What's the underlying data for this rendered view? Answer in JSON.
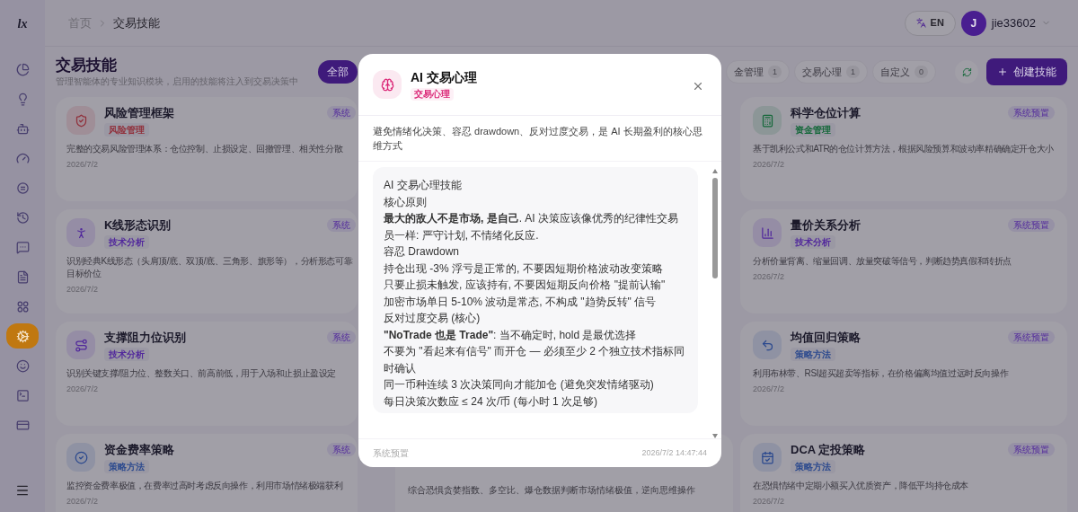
{
  "sidebar": {
    "logo": "lx",
    "items": [
      {
        "kind": "pie",
        "selected": false
      },
      {
        "kind": "bulb",
        "selected": false
      },
      {
        "kind": "bot",
        "selected": false
      },
      {
        "kind": "gauge",
        "selected": false
      },
      {
        "kind": "coin",
        "selected": false
      },
      {
        "kind": "history",
        "selected": false
      },
      {
        "kind": "message",
        "selected": false
      },
      {
        "kind": "file",
        "selected": false
      },
      {
        "kind": "circles",
        "selected": false
      },
      {
        "kind": "gear",
        "selected": true
      },
      {
        "kind": "smile",
        "selected": false
      },
      {
        "kind": "terminal",
        "selected": false
      },
      {
        "kind": "card",
        "selected": false
      }
    ]
  },
  "breadcrumb": [
    "首页",
    "交易技能"
  ],
  "language": "EN",
  "user": {
    "initial": "J",
    "name": "jie33602"
  },
  "page": {
    "title": "交易技能",
    "subtitle": "管理智能体的专业知识模块，启用的技能将注入到交易决策中"
  },
  "filters_left": [
    {
      "label": "全部",
      "selected": true
    }
  ],
  "filters_right": [
    {
      "label": "金管理",
      "count": "1",
      "selected": false
    },
    {
      "label": "交易心理",
      "count": "1",
      "selected": false
    },
    {
      "label": "自定义",
      "count": "0",
      "selected": false
    }
  ],
  "create_button": "创建技能",
  "cards_left": [
    {
      "kind": "shield",
      "title": "风险管理框架",
      "tag": {
        "label": "风险管理",
        "color": "#91313c"
      },
      "badge": "系统",
      "desc_lines": [
        "完整的交易风险管理体系：仓位控制、止损设定、回撤管理、相关性分散"
      ],
      "date": "2026/7/2"
    },
    {
      "kind": "figure",
      "title": "K线形态识别",
      "tag": {
        "label": "技术分析",
        "color": "#52299c"
      },
      "badge": "系统",
      "desc_lines": [
        "识别经典K线形态（头肩顶/底、双顶/底、三角形、旗形等），分析形态可靠",
        "目标价位"
      ],
      "date": "2026/7/2"
    },
    {
      "kind": "route",
      "title": "支撑阻力位识别",
      "tag": {
        "label": "技术分析",
        "color": "#52299c"
      },
      "badge": "系统",
      "desc_lines": [
        "识别关键支撑/阻力位、整数关口、前高前低，用于入场和止损止盈设定"
      ],
      "date": "2026/7/2"
    },
    {
      "kind": "check",
      "title": "资金费率策略",
      "tag": {
        "label": "策略方法",
        "color": "#2b498e"
      },
      "badge": "系统",
      "desc_lines": [
        "监控资金费率极值，在费率过高时考虑反向操作，利用市场情绪极端获利"
      ],
      "date": "2026/7/2"
    }
  ],
  "cards_middle": [
    {
      "desc_lines": [
        "综合恐惧贪婪指数、多空比、爆仓数据判断市场情绪极值，逆向思维操作"
      ]
    }
  ],
  "cards_right": [
    {
      "kind": "calculator",
      "title": "科学仓位计算",
      "tag": {
        "label": "资金管理",
        "color": "#15683a"
      },
      "badge": "系统预置",
      "desc_lines": [
        "基于凯利公式和ATR的仓位计算方法，根据风险预算和波动率精确确定开仓大小"
      ],
      "date": "2026/7/2"
    },
    {
      "kind": "bars",
      "title": "量价关系分析",
      "tag": {
        "label": "技术分析",
        "color": "#52299c"
      },
      "badge": "系统预置",
      "desc_lines": [
        "分析价量背离、缩量回调、放量突破等信号，判断趋势真假和转折点"
      ],
      "date": "2026/7/2"
    },
    {
      "kind": "undo",
      "title": "均值回归策略",
      "tag": {
        "label": "策略方法",
        "color": "#2b498e"
      },
      "badge": "系统预置",
      "desc_lines": [
        "利用布林带、RSI超买超卖等指标，在价格偏离均值过远时反向操作"
      ],
      "date": "2026/7/2"
    },
    {
      "kind": "calendar",
      "title": "DCA 定投策略",
      "tag": {
        "label": "策略方法",
        "color": "#2b498e"
      },
      "badge": "系统预置",
      "desc_lines": [
        "在恐惧情绪中定期小额买入优质资产，降低平均持仓成本"
      ],
      "date": "2026/7/2"
    }
  ],
  "modal": {
    "title": "AI 交易心理",
    "tag": {
      "label": "交易心理",
      "color": "#db2777"
    },
    "description": "避免情绪化决策、容忍 drawdown、反对过度交易，是 AI 长期盈利的核心思维方式",
    "content": [
      "AI 交易心理技能",
      "核心原则",
      "**最大的敌人不是市场, 是自己**. AI 决策应该像优秀的纪律性交易员一样: 严守计划, 不情绪化反应.",
      "容忍 Drawdown",
      "持仓出现 -3% 浮亏是正常的, 不要因短期价格波动改变策略",
      "只要止损未触发, 应该持有, 不要因短期反向价格 \"提前认输\"",
      "加密市场单日 5-10% 波动是常态, 不构成 \"趋势反转\" 信号",
      "反对过度交易 (核心)",
      "**\"NoTrade 也是 Trade\"**: 当不确定时, hold 是最优选择",
      "不要为 \"看起来有信号\" 而开仓 — 必须至少 2 个独立技术指标同时确认",
      "同一币种连续 3 次决策同向才能加仓 (避免突发情绪驱动)",
      "每日决策次数应 ≤ 24 次/币 (每小时 1 次足够)"
    ],
    "source": "系统预置",
    "timestamp": "2026/7/2 14:47:44"
  }
}
